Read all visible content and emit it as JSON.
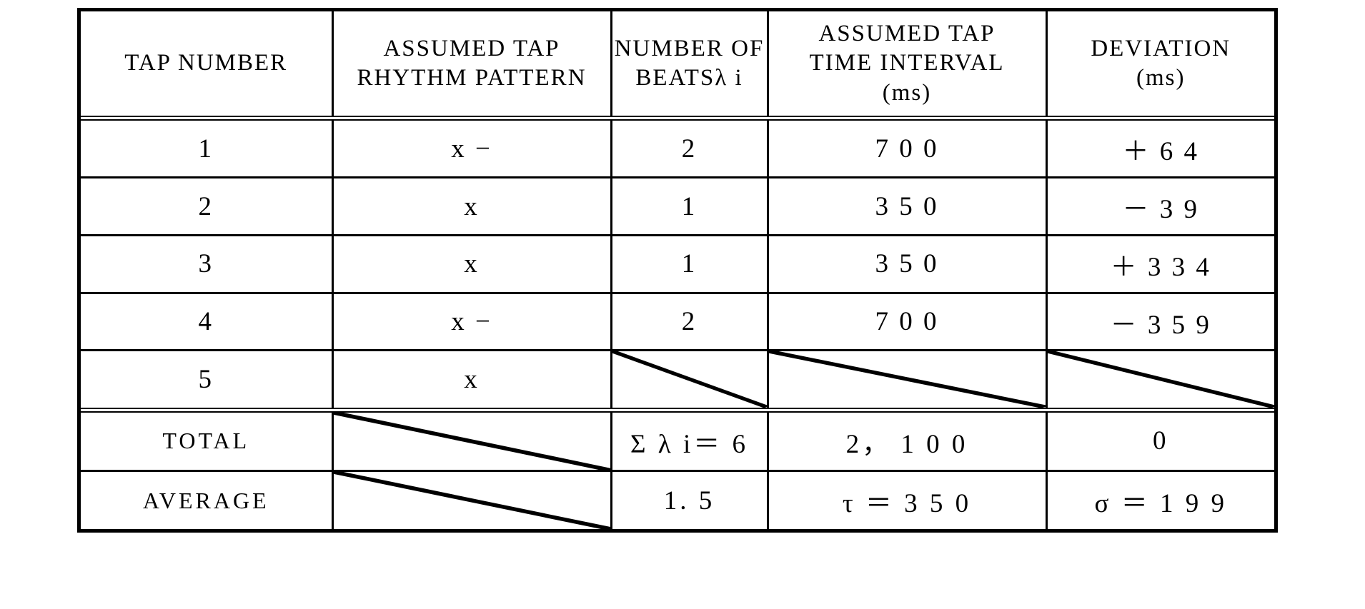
{
  "table": {
    "headers": [
      {
        "lines": [
          "TAP NUMBER"
        ]
      },
      {
        "lines": [
          "ASSUMED TAP",
          "RHYTHM PATTERN"
        ]
      },
      {
        "lines": [
          "NUMBER OF",
          "BEATSλ i"
        ]
      },
      {
        "lines": [
          "ASSUMED TAP",
          "TIME INTERVAL",
          "(ms)"
        ]
      },
      {
        "lines": [
          "DEVIATION",
          "(ms)"
        ]
      }
    ],
    "rows": [
      {
        "tap": "1",
        "pattern": "x −",
        "beats": "2",
        "interval": "7 0 0",
        "deviation": "＋ 6 4"
      },
      {
        "tap": "2",
        "pattern": "x",
        "beats": "1",
        "interval": "3 5 0",
        "deviation": "－ 3 9"
      },
      {
        "tap": "3",
        "pattern": "x",
        "beats": "1",
        "interval": "3 5 0",
        "deviation": "＋ 3 3 4"
      },
      {
        "tap": "4",
        "pattern": "x −",
        "beats": "2",
        "interval": "7 0 0",
        "deviation": "－ 3 5 9"
      },
      {
        "tap": "5",
        "pattern": "x",
        "beats": "",
        "interval": "",
        "deviation": ""
      }
    ],
    "summary": [
      {
        "label": "TOTAL",
        "pattern": "",
        "beats": "Σ λ i＝ 6",
        "interval": "2， 1 0 0",
        "deviation": "0"
      },
      {
        "label": "AVERAGE",
        "pattern": "",
        "beats": "1. 5",
        "interval": "τ ＝ 3 5 0",
        "deviation": "σ ＝ 1 9 9"
      }
    ]
  },
  "colors": {
    "ink": "#000000",
    "paper": "#ffffff"
  }
}
